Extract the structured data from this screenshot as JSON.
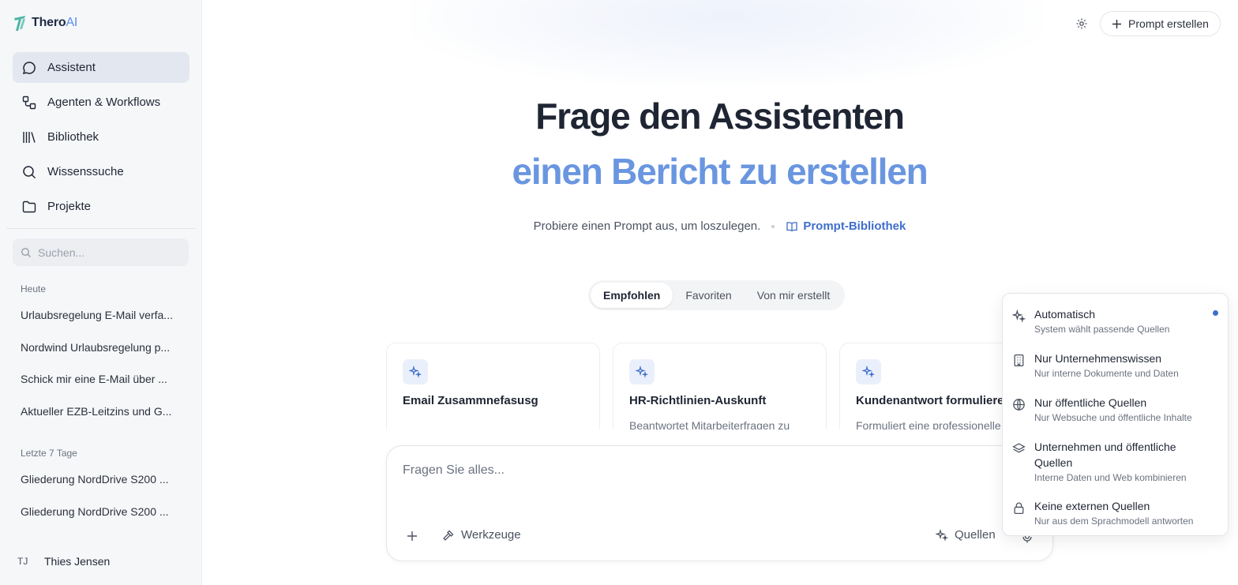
{
  "brand": {
    "name": "Thero",
    "suffix": "AI"
  },
  "nav": [
    {
      "label": "Assistent",
      "icon": "chat-bubble-icon",
      "active": true
    },
    {
      "label": "Agenten & Workflows",
      "icon": "workflow-icon"
    },
    {
      "label": "Bibliothek",
      "icon": "library-icon"
    },
    {
      "label": "Wissenssuche",
      "icon": "search-icon"
    },
    {
      "label": "Projekte",
      "icon": "folder-icon"
    }
  ],
  "search": {
    "placeholder": "Suchen..."
  },
  "history": {
    "today_label": "Heute",
    "today": [
      "Urlaubsregelung E-Mail verfa...",
      "Nordwind Urlaubsregelung p...",
      "Schick mir eine E-Mail über ...",
      "Aktueller EZB-Leitzins und G..."
    ],
    "week_label": "Letzte 7 Tage",
    "week": [
      "Gliederung NordDrive S200 ...",
      "Gliederung NordDrive S200 ..."
    ]
  },
  "user": {
    "initials": "TJ",
    "name": "Thies Jensen"
  },
  "header": {
    "create_prompt": "Prompt erstellen"
  },
  "hero": {
    "title": "Frage den Assistenten",
    "subtitle": "einen Bericht zu erstellen",
    "try_text": "Probiere einen Prompt aus, um loszulegen.",
    "library_link": "Prompt-Bibliothek"
  },
  "tabs": [
    {
      "label": "Empfohlen",
      "active": true
    },
    {
      "label": "Favoriten"
    },
    {
      "label": "Von mir erstellt"
    }
  ],
  "cards": [
    {
      "title": "Email Zusammnefasusg",
      "desc": ""
    },
    {
      "title": "HR-Richtlinien-Auskunft",
      "desc": "Beantwortet Mitarbeiterfragen zu"
    },
    {
      "title": "Kundenantwort formulieren",
      "desc": "Formuliert eine professionelle"
    }
  ],
  "composer": {
    "placeholder": "Fragen Sie alles...",
    "tools_label": "Werkzeuge",
    "sources_label": "Quellen"
  },
  "sources_menu": [
    {
      "title": "Automatisch",
      "desc": "System wählt passende Quellen",
      "icon": "sparkle-icon",
      "selected": true
    },
    {
      "title": "Nur Unternehmenswissen",
      "desc": "Nur interne Dokumente und Daten",
      "icon": "building-icon"
    },
    {
      "title": "Nur öffentliche Quellen",
      "desc": "Nur Websuche und öffentliche Inhalte",
      "icon": "globe-icon"
    },
    {
      "title": "Unternehmen und öffentliche Quellen",
      "desc": "Interne Daten und Web kombinieren",
      "icon": "layers-icon"
    },
    {
      "title": "Keine externen Quellen",
      "desc": "Nur aus dem Sprachmodell antworten",
      "icon": "lock-icon"
    }
  ],
  "colors": {
    "accent": "#3f6fcb",
    "hero_accent": "#6a96e0",
    "sidebar_bg": "#f6f7f9"
  }
}
